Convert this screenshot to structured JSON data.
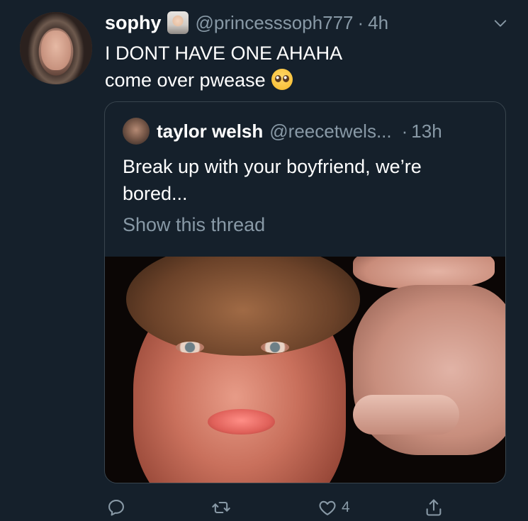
{
  "tweet": {
    "author_name": "sophy",
    "author_handle": "@princesssoph777",
    "dot": "·",
    "time": "4h",
    "text_lines": [
      "I DONT HAVE ONE AHAHA",
      "come over pwease"
    ],
    "avatar_icon": "profile-photo",
    "badge_icon": "person-with-veil-emoji",
    "text_emoji_icon": "pleading-face-emoji"
  },
  "quoted": {
    "author_name": "taylor welsh",
    "author_handle": "@reecetwels...",
    "dot": "·",
    "time": "13h",
    "text_lines": [
      "Break up with your boyfriend, we’re",
      "bored..."
    ],
    "show_thread": "Show this thread"
  },
  "actions": {
    "reply_count": "",
    "retweet_count": "",
    "like_count": "4",
    "share_count": ""
  },
  "colors": {
    "background": "#15202b",
    "text_primary": "#ffffff",
    "text_secondary": "#8899a6",
    "border": "#38444d"
  }
}
